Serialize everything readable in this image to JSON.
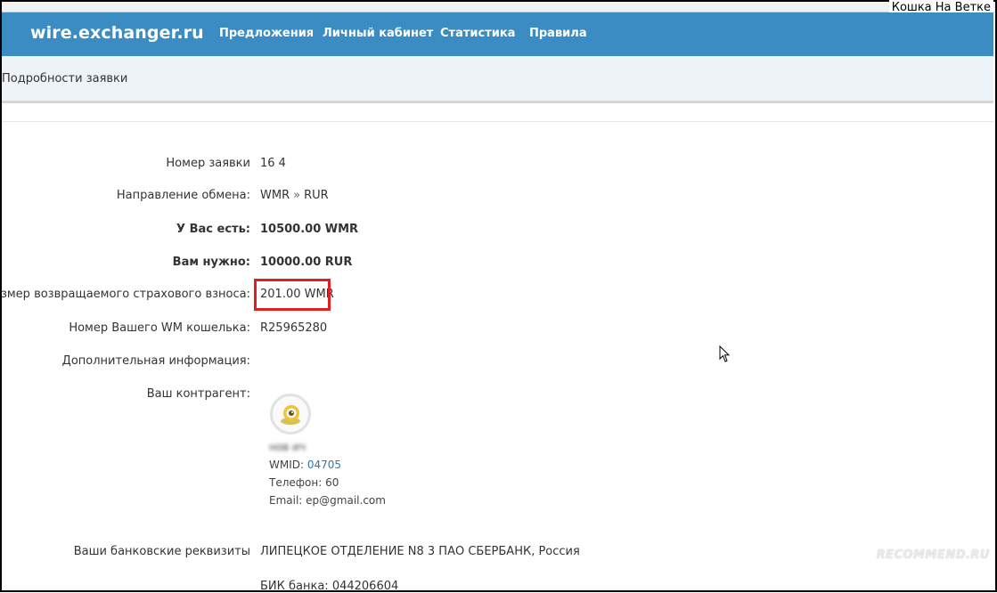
{
  "overlay_tag": "Кошка На Ветке",
  "navbar": {
    "brand": "wire.exchanger.ru",
    "links": [
      "Предложения",
      "Личный кабинет",
      "Статистика",
      "Правила"
    ]
  },
  "page_title": "Подробности заявки",
  "details": {
    "order_number_label": "Номер заявки",
    "order_number_value": "16 4",
    "direction_label": "Направление обмена:",
    "direction_from": "WMR",
    "direction_sep": "»",
    "direction_to": "RUR",
    "have_label": "У Вас есть:",
    "have_value": "10500.00 WMR",
    "need_label": "Вам нужно:",
    "need_value": "10000.00 RUR",
    "deposit_label": "Размер возвращаемого страхового взноса:",
    "deposit_value": "201.00 WMR",
    "wallet_label": "Номер Вашего WM кошелька:",
    "wallet_value": "R25965280",
    "extra_label": "Дополнительная информация:",
    "counterparty_label": "Ваш контрагент:"
  },
  "counterparty": {
    "name": "нов ич",
    "wmid_label": "WMID:",
    "wmid_value": "04705",
    "phone_label": "Телефон:",
    "phone_value": "60",
    "email_label": "Email:",
    "email_value": "ep@gmail.com"
  },
  "bank": {
    "label": "Ваши банковские реквизиты",
    "value": "ЛИПЕЦКОЕ ОТДЕЛЕНИЕ N8 3 ПАО СБЕРБАНК, Россия",
    "bik_line": "БИК банка: 044206604"
  },
  "watermark": "RECOMMEND.RU"
}
